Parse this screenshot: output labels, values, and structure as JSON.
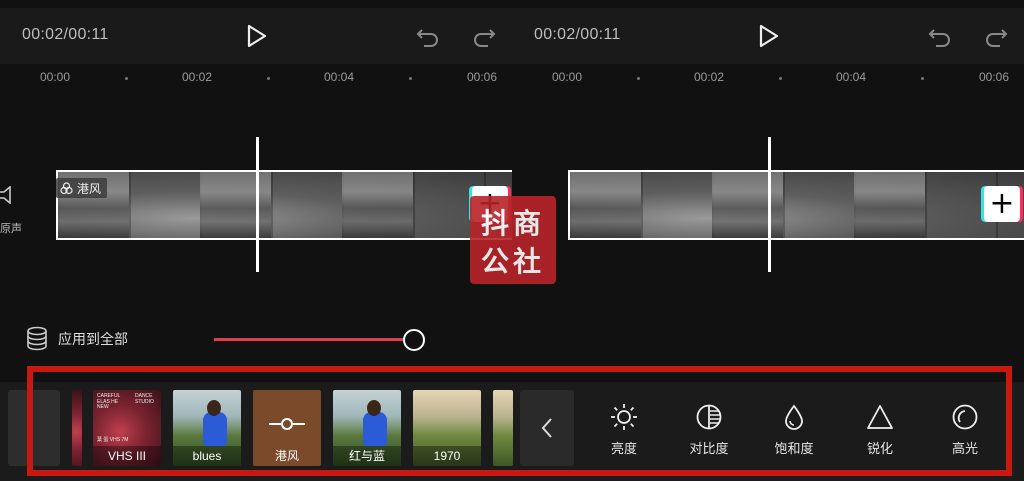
{
  "player": {
    "time": "00:02/00:11"
  },
  "ruler": {
    "ticks": [
      "00:00",
      "00:02",
      "00:04",
      "00:06"
    ]
  },
  "track": {
    "filter_tag": "港风",
    "audio_label": "原声"
  },
  "apply_all": {
    "label": "应用到全部"
  },
  "intensity": {
    "value_percent": 100
  },
  "filters": [
    {
      "name": "VHS III",
      "style": "album"
    },
    {
      "name": "blues",
      "style": "girl"
    },
    {
      "name": "港风",
      "style": "active",
      "selected": true
    },
    {
      "name": "红与蓝",
      "style": "girl"
    },
    {
      "name": "1970",
      "style": "warm"
    }
  ],
  "album_text": {
    "top_left": "CAREFUL ELAS HE NEW",
    "top_right": "DANCE STUDIO",
    "bottom": "葉 蛋 VHS 7M"
  },
  "tools": [
    {
      "name": "brightness",
      "label": "亮度",
      "icon": "sun-icon"
    },
    {
      "name": "contrast",
      "label": "对比度",
      "icon": "contrast-icon"
    },
    {
      "name": "saturation",
      "label": "饱和度",
      "icon": "drop-icon"
    },
    {
      "name": "sharpen",
      "label": "锐化",
      "icon": "triangle-icon"
    },
    {
      "name": "highlight",
      "label": "高光",
      "icon": "highlight-icon"
    }
  ],
  "watermark": {
    "line1": "抖商",
    "line2": "公社"
  },
  "colors": {
    "accent_red": "#e23b53",
    "highlight_border": "#c8180f",
    "add_cyan": "#2ee6e6",
    "add_pink": "#ff2d55"
  }
}
